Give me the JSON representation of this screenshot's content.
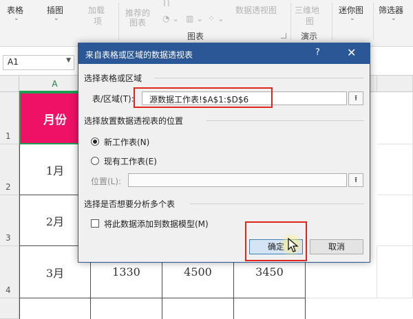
{
  "ribbon": {
    "table_label": "表格",
    "illustration_label": "插图",
    "addins_label": "加载",
    "addins_sub": "项",
    "recommended_charts_label": "推荐的",
    "recommended_charts_sub": "图表",
    "pivot_chart_label": "数据透视图",
    "map_3d_label": "三维地",
    "map_3d_sub": "图",
    "sparklines_label": "迷你图",
    "slicer_label": "筛选器",
    "charts_group_label": "图表",
    "tours_group_label": "演示"
  },
  "formula_bar": {
    "name_box": "A1"
  },
  "sheet": {
    "col_a": "A",
    "row_numbers": [
      "1",
      "2",
      "3",
      "4"
    ],
    "header_cell": "月份",
    "month_cells": [
      "1月",
      "2月",
      "3月"
    ],
    "row3_values": [
      "1330",
      "4500",
      "3450"
    ]
  },
  "dialog": {
    "title": "来自表格或区域的数据透视表",
    "help": "?",
    "close": "✕",
    "section_source": "选择表格或区域",
    "range_label": "表/区域(T):",
    "range_value": "源数据工作表!$A$1:$D$6",
    "section_location": "选择放置数据透视表的位置",
    "new_sheet_label": "新工作表(N)",
    "existing_sheet_label": "现有工作表(E)",
    "location_label": "位置(L):",
    "location_value": "",
    "section_multiple": "选择是否想要分析多个表",
    "data_model_label": "将此数据添加到数据模型(M)",
    "ok_label": "确定",
    "cancel_label": "取消"
  },
  "colors": {
    "title_bar": "#2b5797",
    "header_fill": "#ee1166",
    "highlight": "#e0241b"
  }
}
